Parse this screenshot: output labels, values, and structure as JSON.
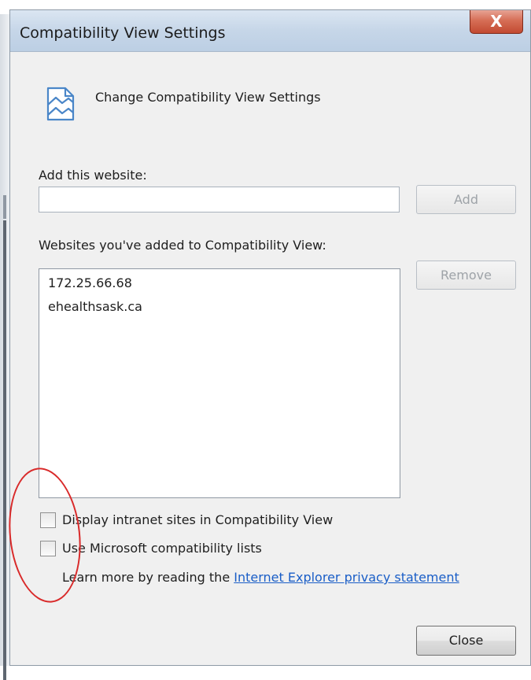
{
  "window": {
    "title": "Compatibility View Settings",
    "close_glyph": "X"
  },
  "header": {
    "icon": "compatibility-view-icon",
    "text": "Change Compatibility View Settings"
  },
  "add_site": {
    "label": "Add this website:",
    "value": "",
    "button": "Add"
  },
  "sites": {
    "label": "Websites you've added to Compatibility View:",
    "items": [
      "172.25.66.68",
      "ehealthsask.ca"
    ],
    "remove_button": "Remove"
  },
  "options": [
    {
      "label": "Display intranet sites in Compatibility View",
      "checked": false
    },
    {
      "label": "Use Microsoft compatibility lists",
      "checked": false
    }
  ],
  "learn_more": {
    "prefix": "Learn more by reading the ",
    "link": "Internet Explorer privacy statement"
  },
  "footer": {
    "close_button": "Close"
  },
  "colors": {
    "annotation": "#d92a2a",
    "link": "#1a5ec7",
    "close_button_red": "#c24a31"
  }
}
